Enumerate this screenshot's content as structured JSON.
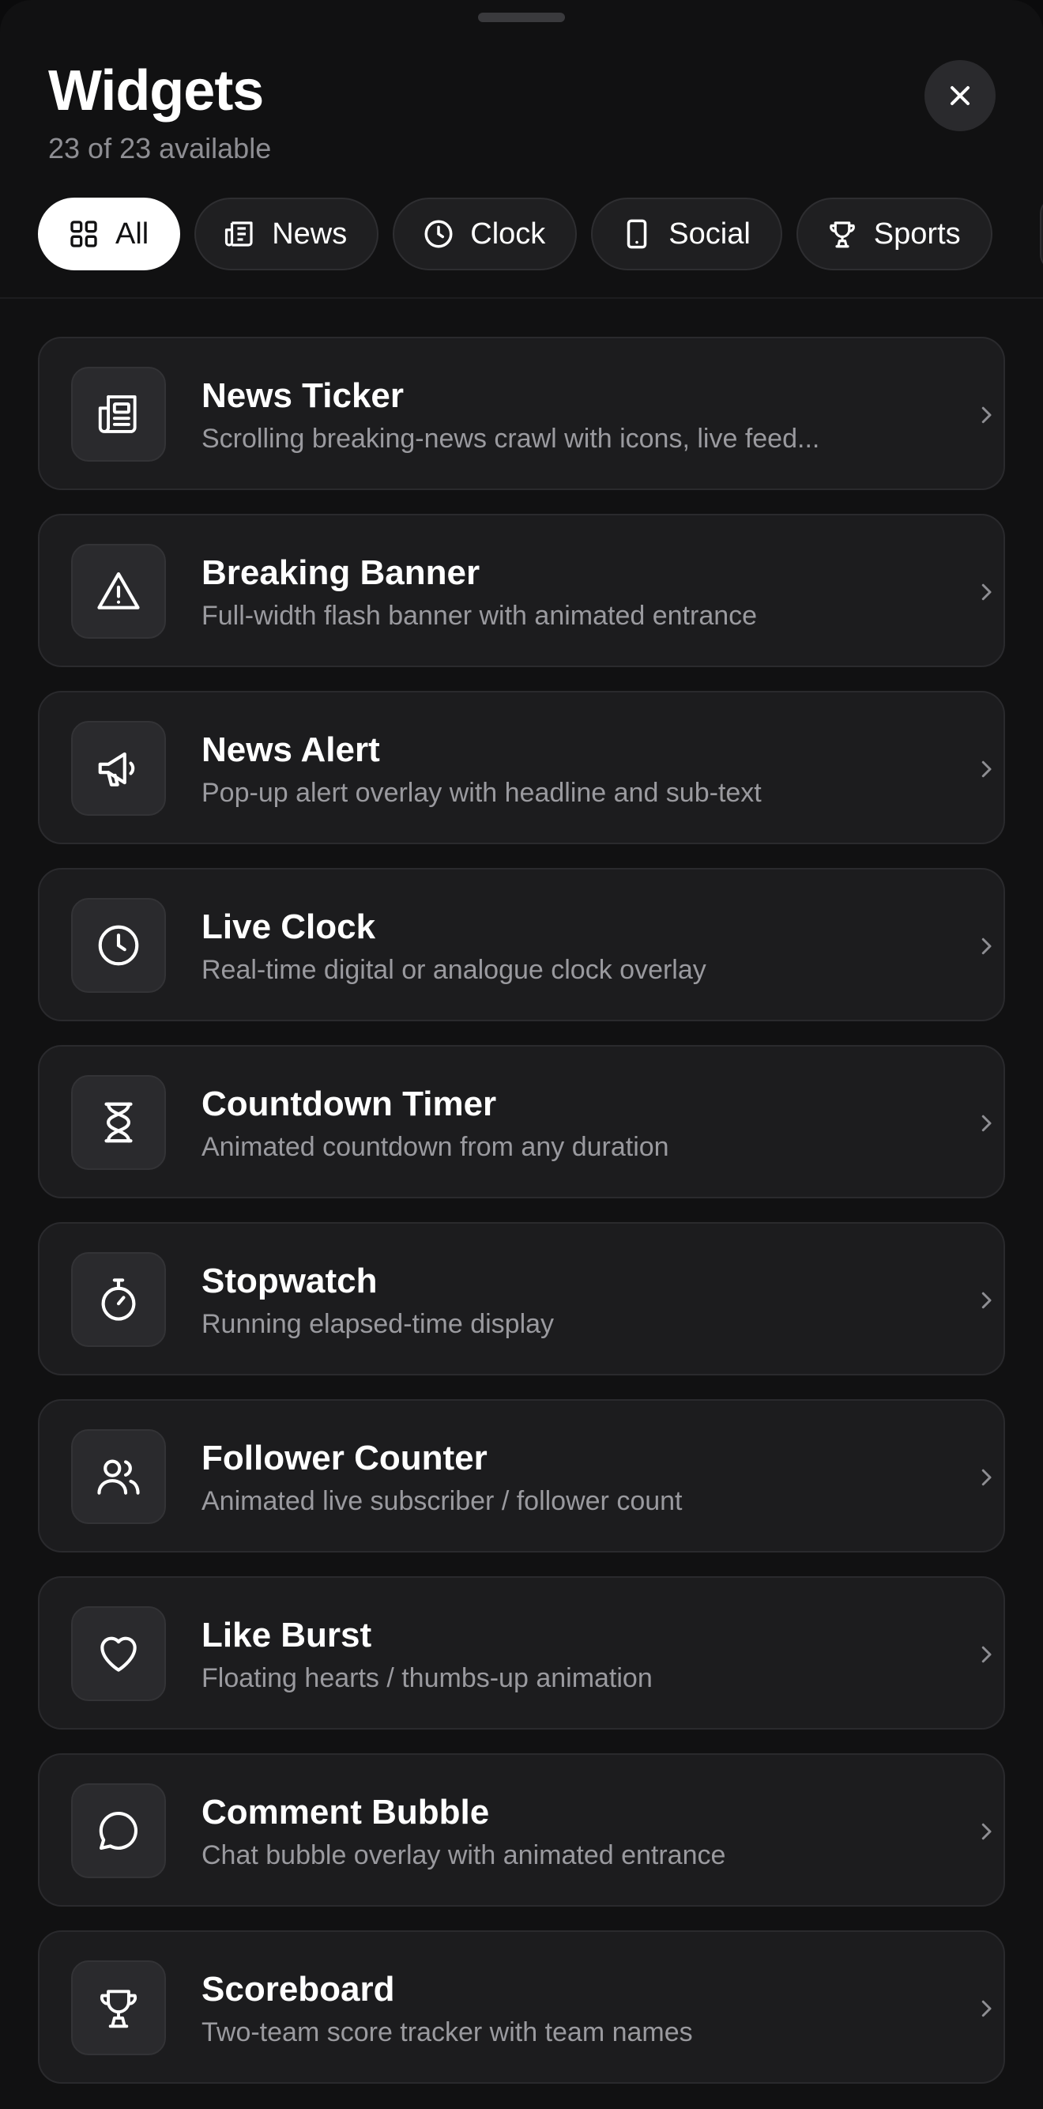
{
  "header": {
    "title": "Widgets",
    "subtitle": "23 of 23 available",
    "close_icon": "close-icon"
  },
  "filters": [
    {
      "label": "All",
      "icon": "grid-icon",
      "active": true
    },
    {
      "label": "News",
      "icon": "newspaper-icon",
      "active": false
    },
    {
      "label": "Clock",
      "icon": "clock-icon",
      "active": false
    },
    {
      "label": "Social",
      "icon": "phone-icon",
      "active": false
    },
    {
      "label": "Sports",
      "icon": "trophy-icon",
      "active": false
    }
  ],
  "widgets": [
    {
      "title": "News Ticker",
      "description": "Scrolling breaking-news crawl with icons, live feed...",
      "icon": "newspaper-icon"
    },
    {
      "title": "Breaking Banner",
      "description": "Full-width flash banner with animated entrance",
      "icon": "warning-icon"
    },
    {
      "title": "News Alert",
      "description": "Pop-up alert overlay with headline and sub-text",
      "icon": "megaphone-icon"
    },
    {
      "title": "Live Clock",
      "description": "Real-time digital or analogue clock overlay",
      "icon": "clock-icon"
    },
    {
      "title": "Countdown Timer",
      "description": "Animated countdown from any duration",
      "icon": "hourglass-icon"
    },
    {
      "title": "Stopwatch",
      "description": "Running elapsed-time display",
      "icon": "stopwatch-icon"
    },
    {
      "title": "Follower Counter",
      "description": "Animated live subscriber / follower count",
      "icon": "users-icon"
    },
    {
      "title": "Like Burst",
      "description": "Floating hearts / thumbs-up animation",
      "icon": "heart-icon"
    },
    {
      "title": "Comment Bubble",
      "description": "Chat bubble overlay with animated entrance",
      "icon": "chat-bubble-icon"
    },
    {
      "title": "Scoreboard",
      "description": "Two-team score tracker with team names",
      "icon": "trophy-icon"
    }
  ],
  "colors": {
    "background": "#111112",
    "card": "#1c1c1e",
    "active_tab": "#ffffff",
    "muted_text": "#9a9a9f"
  }
}
